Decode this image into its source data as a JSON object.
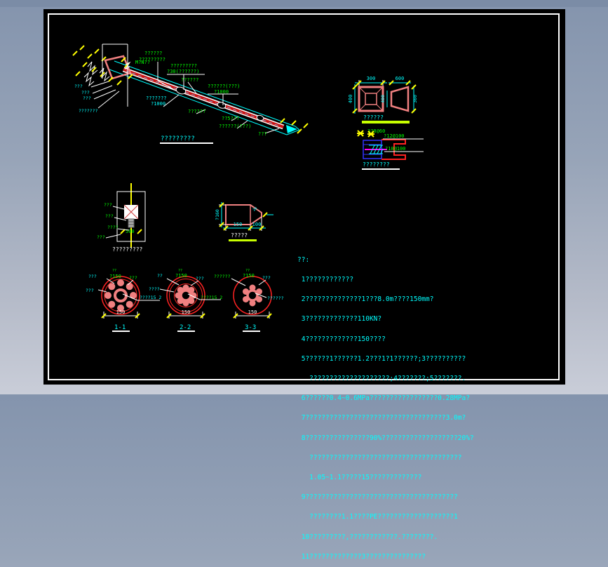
{
  "anchor": {
    "title": "?????????",
    "head1": "???",
    "head2": "???",
    "head3": "???",
    "head4": "???????",
    "mn": "M?N??",
    "top1": "??????",
    "top2": "?????????",
    "bolt1": "?????????",
    "bolt2": "?30(??????)",
    "mid": "??????",
    "grout1": "??????(???)",
    "grout2": "?1000",
    "pipe1": "???????",
    "pipe2": "?1000",
    "seg": "??????",
    "len25": "??5???",
    "tail": "??????(???)",
    "tip": "???"
  },
  "square": {
    "dim_w": "300",
    "dim_h": "400",
    "caption": "??????"
  },
  "trap": {
    "dim_w": "600",
    "dim_h1": "400",
    "dim_h2": "360"
  },
  "weld": {
    "top": "3?8@60",
    "r1": "?12@100",
    "r2": "?10@100",
    "caption": "????????"
  },
  "post": {
    "l1": "???",
    "l2": "???",
    "l3": "????",
    "l4": "???",
    "dim": "500",
    "caption": "?????????"
  },
  "cone": {
    "dia": "?160",
    "slant": "20",
    "d150": "150",
    "d100": "100",
    "caption": "?????"
  },
  "sections": [
    {
      "tl": "???",
      "marks": "??",
      "dia": "?150",
      "tr": "???",
      "left": "???",
      "right": "????15 2",
      "dim": "150",
      "caption": "1-1"
    },
    {
      "tl": "??",
      "marks": "??",
      "dia": "?150",
      "tr": "???",
      "left": "????",
      "right": "????15 2",
      "dim": "150",
      "caption": "2-2"
    },
    {
      "tl": "??????",
      "marks": "??",
      "dia": "?150",
      "tr": "???",
      "left": "",
      "right": "??????",
      "dim": "150",
      "caption": "3-3"
    }
  ],
  "notes": {
    "lines": [
      "??:",
      " 1????????????",
      " 2??????????????1???8.0m????150mm?",
      " 3?????????????110KN?",
      " 4?????????????150????",
      " 5??????1??????1.2???1?1??????;3??????????",
      "   ????????????????????;4???????;5???????.",
      " 6??????0.4~0.6MPa?????????????????0.28MPa?",
      " 7???????????????????????????????????3.0m?",
      " 8????????????????90%???????????????????20%?",
      "   ??????????????????????????????????????",
      "   1.05~1.1?????15?????????????",
      " 9??????????????????????????????????????",
      "   ????????1.1????PE???????????????????1",
      " 10?????????,????????????.????????.",
      " 11?????????????3???????????????"
    ]
  }
}
